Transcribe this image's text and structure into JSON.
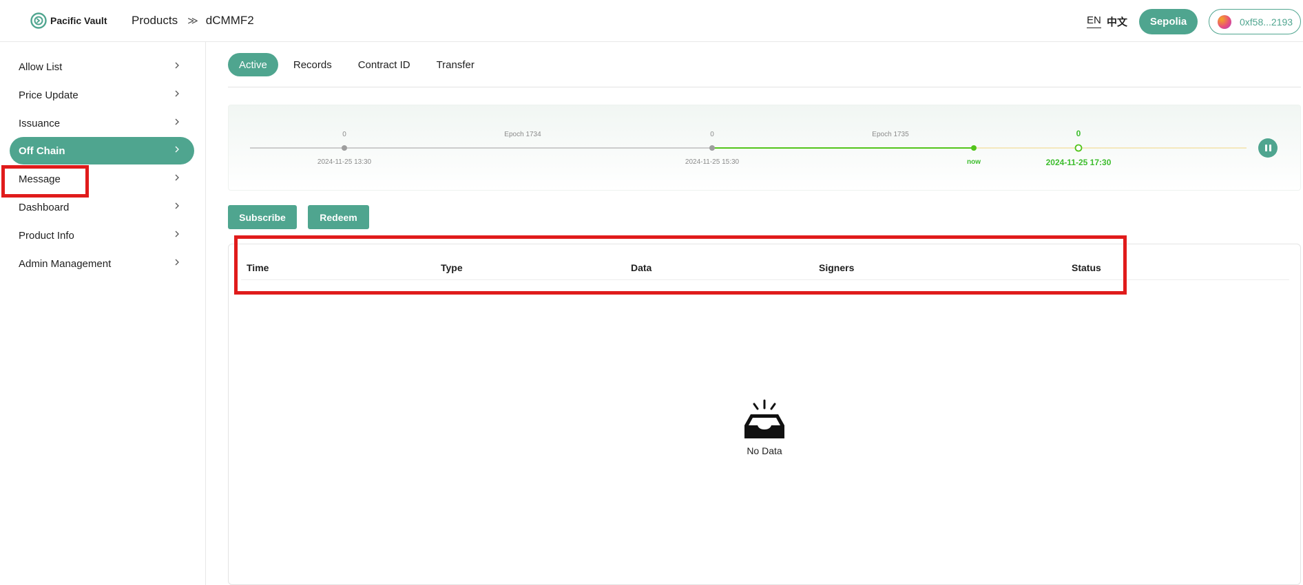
{
  "brand": {
    "name": "Pacific Vault"
  },
  "breadcrumb": {
    "root": "Products",
    "separator": "≫",
    "current": "dCMMF2"
  },
  "header": {
    "lang_en": "EN",
    "lang_zh": "中文",
    "network_label": "Sepolia",
    "wallet_address": "0xf58...2193"
  },
  "sidebar": {
    "items": [
      {
        "label": "Allow List",
        "active": false
      },
      {
        "label": "Price Update",
        "active": false
      },
      {
        "label": "Issuance",
        "active": false
      },
      {
        "label": "Off Chain",
        "active": true
      },
      {
        "label": "Message",
        "active": false
      },
      {
        "label": "Dashboard",
        "active": false
      },
      {
        "label": "Product Info",
        "active": false
      },
      {
        "label": "Admin Management",
        "active": false
      }
    ]
  },
  "tabs": [
    {
      "label": "Active",
      "active": true
    },
    {
      "label": "Records",
      "active": false
    },
    {
      "label": "Contract ID",
      "active": false
    },
    {
      "label": "Transfer",
      "active": false
    }
  ],
  "timeline": {
    "points": [
      {
        "count": "0",
        "date": "2024-11-25 13:30"
      },
      {
        "count": "0",
        "date": "2024-11-25 15:30"
      },
      {
        "count": "0",
        "date": "2024-11-25 17:30"
      }
    ],
    "epochs": [
      "Epoch 1734",
      "Epoch 1735"
    ],
    "now_label": "now",
    "colors": {
      "past": "#bdbdbd",
      "active": "#52c41a",
      "future": "#f3e2a9"
    }
  },
  "actions": {
    "subscribe": "Subscribe",
    "redeem": "Redeem"
  },
  "table": {
    "columns": [
      "Time",
      "Type",
      "Data",
      "Signers",
      "Status"
    ],
    "rows": [],
    "empty_text": "No Data"
  },
  "theme": {
    "accent": "#4fa58f",
    "highlight": "#e01b1b"
  }
}
